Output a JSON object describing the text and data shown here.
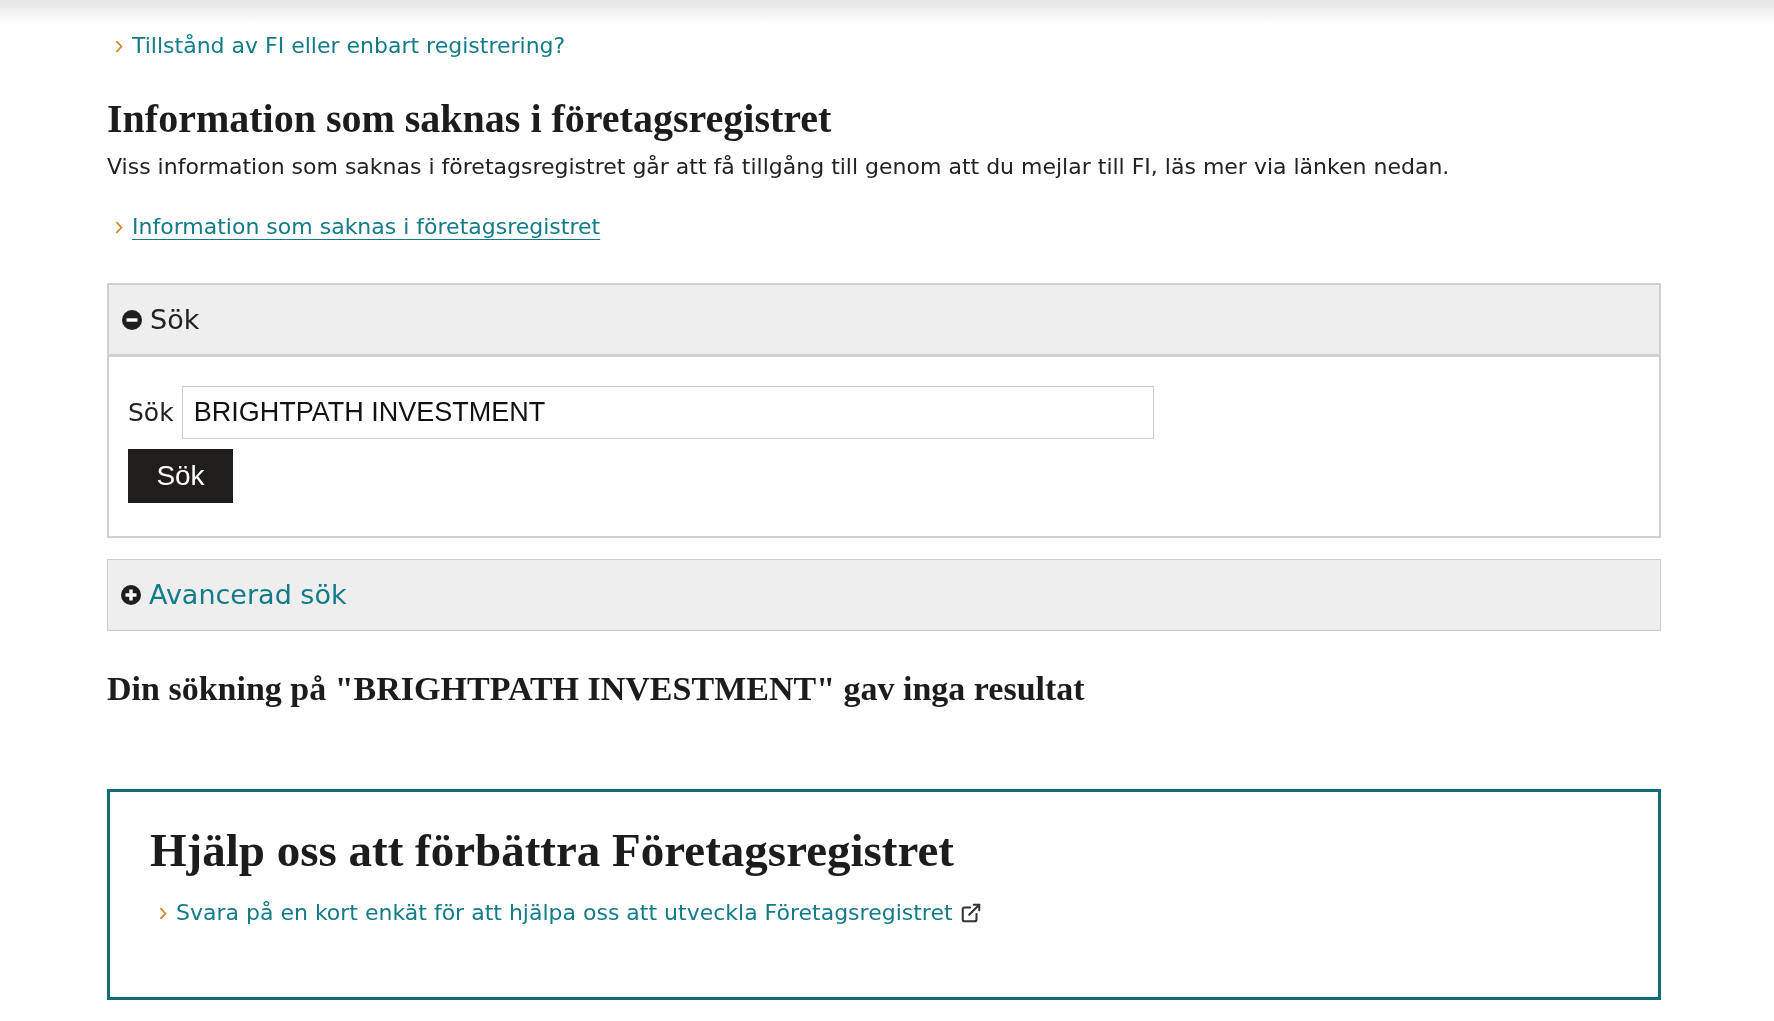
{
  "top_link": {
    "text": "Tillstånd av FI eller enbart registrering?"
  },
  "missing_info": {
    "heading": "Information som saknas i företagsregistret",
    "text": "Viss information som saknas i företagsregistret går att få tillgång till genom att du mejlar till FI, läs mer via länken nedan.",
    "link": "Information som saknas i företagsregistret"
  },
  "search_panel": {
    "title": "Sök",
    "expanded": true,
    "field_label": "Sök",
    "value": "BRIGHTPATH INVESTMENT",
    "button": "Sök"
  },
  "advanced_search_panel": {
    "title": "Avancerad sök",
    "expanded": false
  },
  "result_heading": "Din sökning på \"BRIGHTPATH INVESTMENT\" gav inga resultat",
  "feedback_box": {
    "heading": "Hjälp oss att förbättra Företagsregistret",
    "link": "Svara på en kort enkät för att hjälpa oss att utveckla Företagsregistret",
    "external": true
  }
}
